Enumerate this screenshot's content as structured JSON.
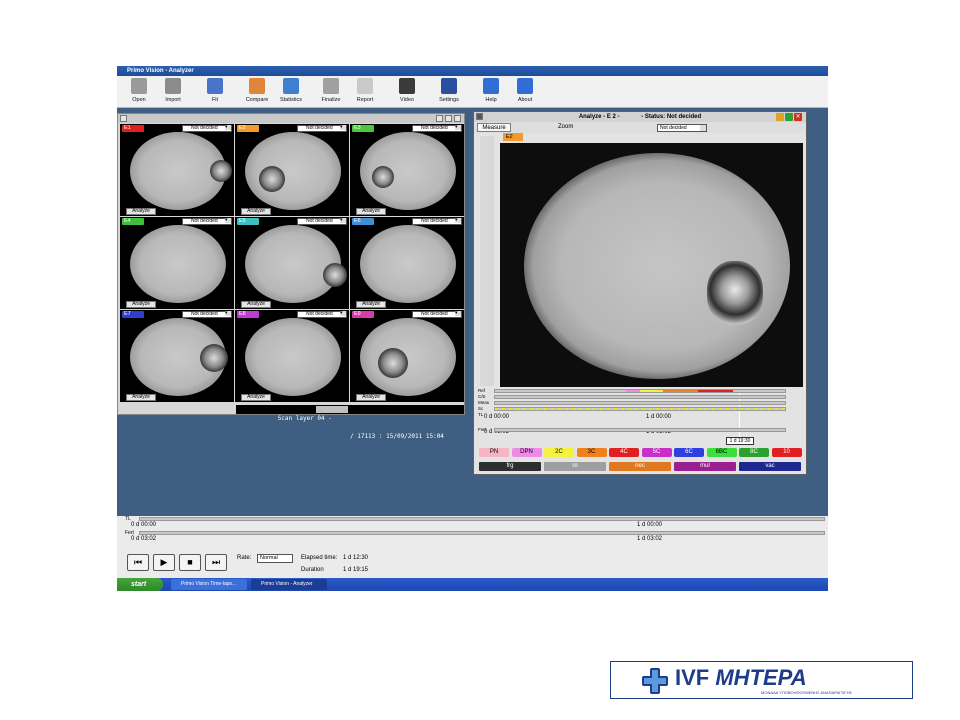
{
  "app": {
    "title": "Primo Vision - Analyzer"
  },
  "toolbar": [
    {
      "label": "Open",
      "icon": "open-icon",
      "color": "#9a9a9a"
    },
    {
      "label": "Import",
      "icon": "import-icon",
      "color": "#8c8c8c"
    },
    {
      "label": "Fit",
      "icon": "fit-icon",
      "color": "#4a74c9"
    },
    {
      "label": "Compare",
      "icon": "compare-icon",
      "color": "#e0863a"
    },
    {
      "label": "Statistics",
      "icon": "statistics-icon",
      "color": "#3d7fd0"
    },
    {
      "label": "Finalize",
      "icon": "lock-icon",
      "color": "#a0a0a0"
    },
    {
      "label": "Report",
      "icon": "report-icon",
      "color": "#c9c9c9"
    },
    {
      "label": "Video",
      "icon": "video-icon",
      "color": "#3a3a3a"
    },
    {
      "label": "Settings",
      "icon": "settings-icon",
      "color": "#2a4f9e"
    },
    {
      "label": "Help",
      "icon": "help-icon",
      "color": "#2f6fd3"
    },
    {
      "label": "About",
      "icon": "info-icon",
      "color": "#2f6fd3"
    }
  ],
  "grid": {
    "cells": [
      {
        "id": "E1",
        "color": "#e02020",
        "status": "Not decided",
        "action": "Analyze"
      },
      {
        "id": "E2",
        "color": "#f29a2e",
        "status": "Not decided",
        "action": "Analyze"
      },
      {
        "id": "E3",
        "color": "#48c83a",
        "status": "Not decided",
        "action": "Analyze"
      },
      {
        "id": "E4",
        "color": "#3fbf3a",
        "status": "Not decided",
        "action": "Analyze"
      },
      {
        "id": "E5",
        "color": "#3fc0c0",
        "status": "Not decided",
        "action": "Analyze"
      },
      {
        "id": "E6",
        "color": "#3f8fd8",
        "status": "Not decided",
        "action": "Analyze"
      },
      {
        "id": "E7",
        "color": "#2b3fd0",
        "status": "Not decided",
        "action": "Analyze"
      },
      {
        "id": "E8",
        "color": "#c03ad8",
        "status": "Not decided",
        "action": "Analyze"
      },
      {
        "id": "E9",
        "color": "#d83aa8",
        "status": "Not decided",
        "action": "Analyze"
      }
    ],
    "scan_left": "Scan layer 04 -",
    "scan_right": "/ 17113 : 15/09/2011 15:04"
  },
  "analyze": {
    "title": "Analyze - E 2 -",
    "status": "- Status: Not decided",
    "measure_tab": "Measure",
    "zoom_label": "Zoom",
    "decision": "Not decided",
    "embryo_tag": "E2",
    "rows": [
      "Ref",
      "C/E",
      "Meas",
      "Sc",
      "TL",
      "Fert"
    ],
    "tl_start": "0 d 00:00",
    "tl_mid": "1 d 00:00",
    "fert_start": "0 d 03:02",
    "fert_mid": "1 d 03:02",
    "cursor_time": "1 d 19:30",
    "stages": [
      {
        "label": "PN",
        "color": "#f7b4c4",
        "text": "#000"
      },
      {
        "label": "DPN",
        "color": "#f08ae8",
        "text": "#000"
      },
      {
        "label": "2C",
        "color": "#f4f23a",
        "text": "#000"
      },
      {
        "label": "3C",
        "color": "#f0821e",
        "text": "#000"
      },
      {
        "label": "4C",
        "color": "#e02020",
        "text": "#fff"
      },
      {
        "label": "5C",
        "color": "#c82fc8",
        "text": "#fff"
      },
      {
        "label": "6C",
        "color": "#2f3fe0",
        "text": "#fff"
      },
      {
        "label": "6BC",
        "color": "#3ae03a",
        "text": "#000"
      },
      {
        "label": "8C",
        "color": "#2ea02e",
        "text": "#fff"
      },
      {
        "label": "10",
        "color": "#e02020",
        "text": "#fff"
      }
    ],
    "tags": [
      {
        "label": "frg",
        "color": "#2e2e2e"
      },
      {
        "label": "re",
        "color": "#9e9e9e"
      },
      {
        "label": "nec",
        "color": "#e07820"
      },
      {
        "label": "mul",
        "color": "#9a2090"
      },
      {
        "label": "vac",
        "color": "#1e2690"
      }
    ]
  },
  "timeline": {
    "tl_label": "TL",
    "fert_label": "Fert",
    "tl_start": "0 d 00:00",
    "tl_mid": "1 d 00:00",
    "fert_start": "0 d 03:02",
    "fert_mid": "1 d 03:02"
  },
  "playback": {
    "rate_label": "Rate:",
    "rate_value": "Normal",
    "elapsed_label": "Elapsed time:",
    "elapsed_value": "1 d 12:30",
    "duration_label": "Duration",
    "duration_value": "1 d 19:15"
  },
  "taskbar": {
    "start": "start",
    "tasks": [
      "Primo Vision Time-laps...",
      "Primo Vision - Analyzer"
    ]
  },
  "logo": {
    "text_a": "IVF",
    "text_b": "ΜΗΤΕΡΑ",
    "subtitle": "ΜΟΝΑΔΑ ΥΠΟΒΟΗΘΟΥΜΕΝΗΣ ΑΝΑΠΑΡΑΓΩΓΗΣ"
  }
}
